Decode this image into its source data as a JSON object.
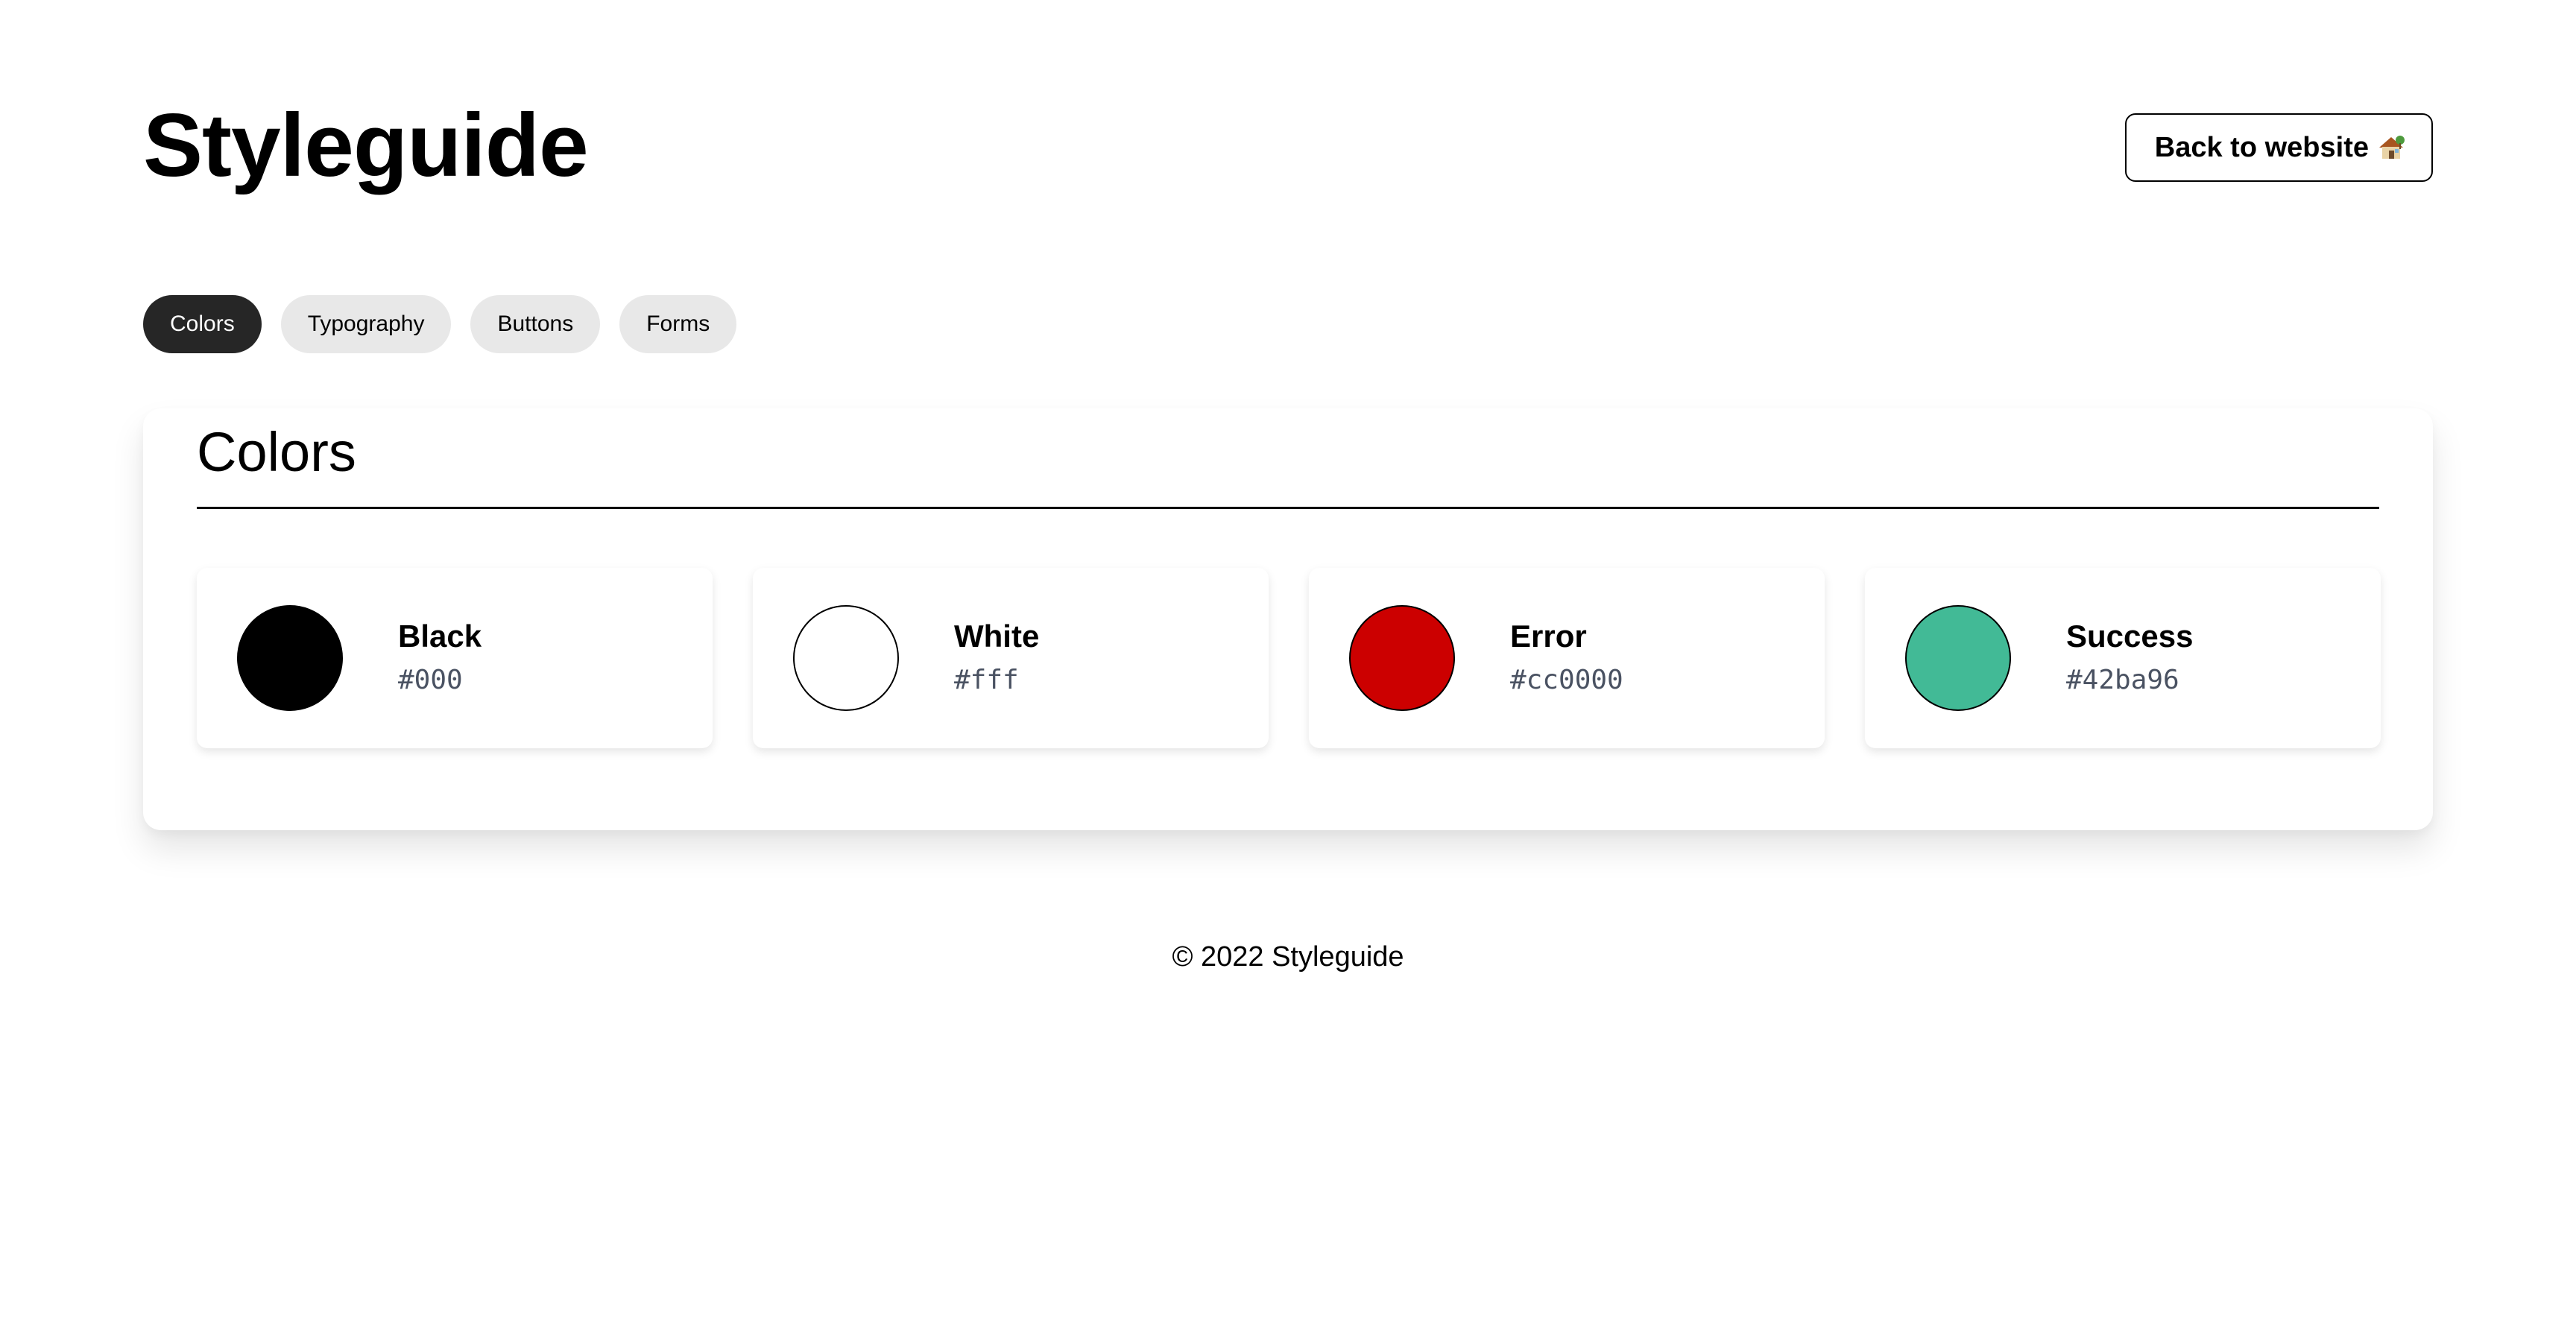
{
  "header": {
    "title": "Styleguide",
    "back_button_label": "Back to website",
    "back_button_icon": "house-icon"
  },
  "tabs": [
    {
      "label": "Colors",
      "active": true
    },
    {
      "label": "Typography",
      "active": false
    },
    {
      "label": "Buttons",
      "active": false
    },
    {
      "label": "Forms",
      "active": false
    }
  ],
  "section": {
    "title": "Colors",
    "swatches": [
      {
        "name": "Black",
        "hex": "#000",
        "color": "#000000"
      },
      {
        "name": "White",
        "hex": "#fff",
        "color": "#ffffff"
      },
      {
        "name": "Error",
        "hex": "#cc0000",
        "color": "#cc0000"
      },
      {
        "name": "Success",
        "hex": "#42ba96",
        "color": "#42ba96"
      }
    ]
  },
  "footer": {
    "text": "© 2022 Styleguide"
  }
}
